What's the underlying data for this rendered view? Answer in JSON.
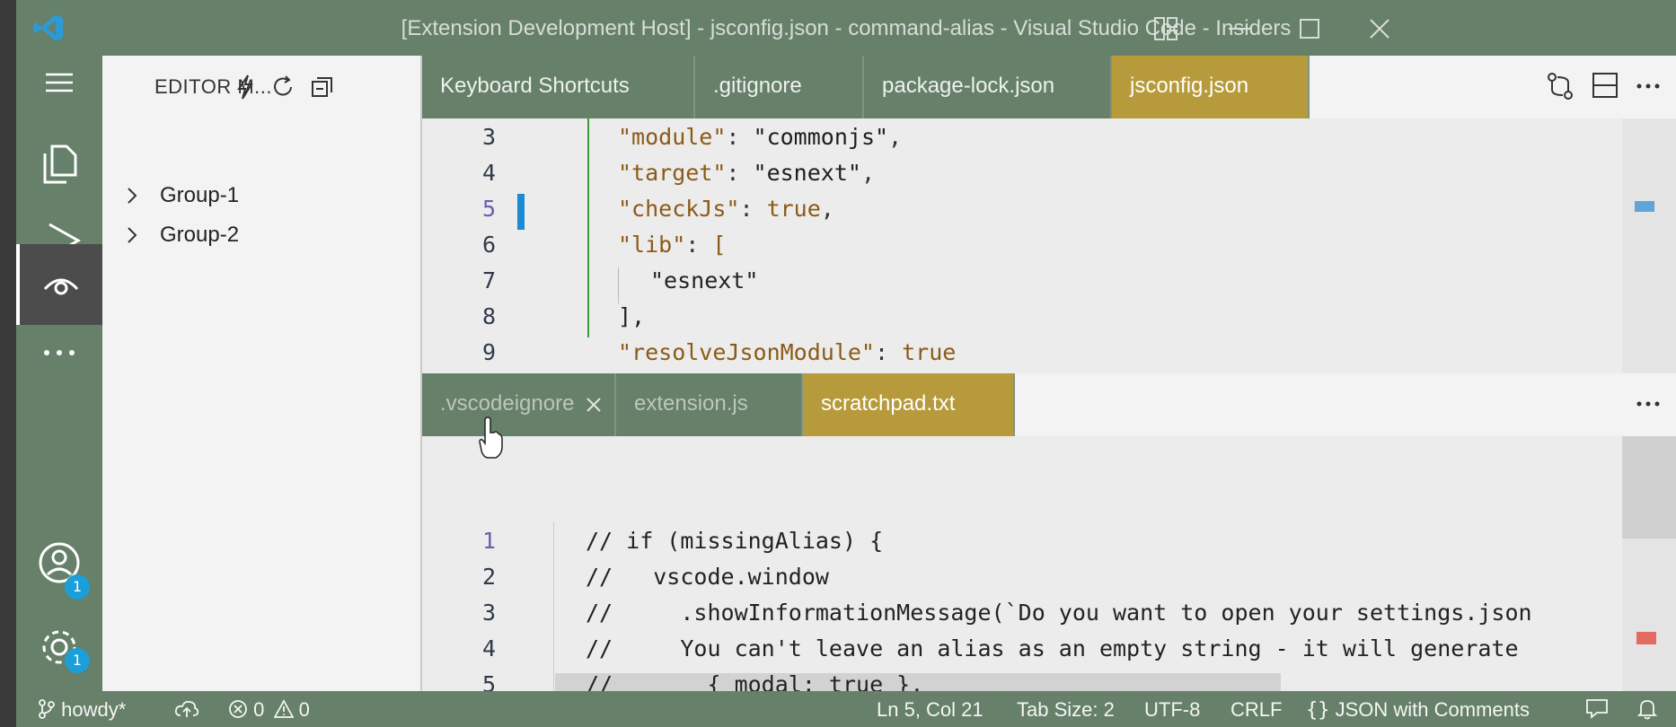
{
  "window": {
    "title": "[Extension Development Host] - jsconfig.json - command-alias - Visual Studio Code - Insiders"
  },
  "activity_bar": {
    "items": [
      {
        "name": "explorer",
        "icon": "files-icon"
      },
      {
        "name": "run-and-debug",
        "icon": "run-debug-icon"
      },
      {
        "name": "editor-manager",
        "icon": "eye-icon",
        "active": true
      },
      {
        "name": "more",
        "icon": "more-icon"
      }
    ],
    "accounts_badge": "1",
    "settings_badge": "1"
  },
  "sidebar": {
    "title": "EDITOR M...",
    "groups": [
      {
        "label": "Group-1"
      },
      {
        "label": "Group-2"
      }
    ]
  },
  "top_group": {
    "tabs": [
      {
        "label": "Keyboard Shortcuts"
      },
      {
        "label": ".gitignore"
      },
      {
        "label": "package-lock.json"
      },
      {
        "label": "jsconfig.json",
        "active": true
      }
    ],
    "line_numbers": [
      "3",
      "4",
      "5",
      "6",
      "7",
      "8",
      "9"
    ],
    "lines": [
      {
        "key": "\"module\"",
        "value": "\"commonjs\"",
        "tail": ","
      },
      {
        "key": "\"target\"",
        "value": "\"esnext\"",
        "tail": ","
      },
      {
        "key": "\"checkJs\"",
        "value": "true",
        "tail": ","
      },
      {
        "key": "\"lib\"",
        "value": "[",
        "tail": ""
      },
      {
        "text": "\"esnext\""
      },
      {
        "text": "],"
      },
      {
        "key": "\"resolveJsonModule\"",
        "value": "true",
        "tail": ""
      }
    ]
  },
  "bottom_group": {
    "tabs": [
      {
        "label": ".vscodeignore"
      },
      {
        "label": "extension.js"
      },
      {
        "label": "scratchpad.txt",
        "active": true
      }
    ],
    "line_numbers": [
      "1",
      "2",
      "3",
      "4",
      "5"
    ],
    "lines": [
      "// if (missingAlias) {",
      "//   vscode.window",
      "//     .showInformationMessage(`Do you want to open your settings.json",
      "//     You can't leave an alias as an empty string - it will generate",
      "//       { modal: true },"
    ]
  },
  "status_bar": {
    "branch": "howdy*",
    "errors": "0",
    "warnings": "0",
    "cursor": "Ln 5, Col 21",
    "tab_size": "Tab Size: 2",
    "encoding": "UTF-8",
    "eol": "CRLF",
    "language": "JSON with Comments"
  }
}
